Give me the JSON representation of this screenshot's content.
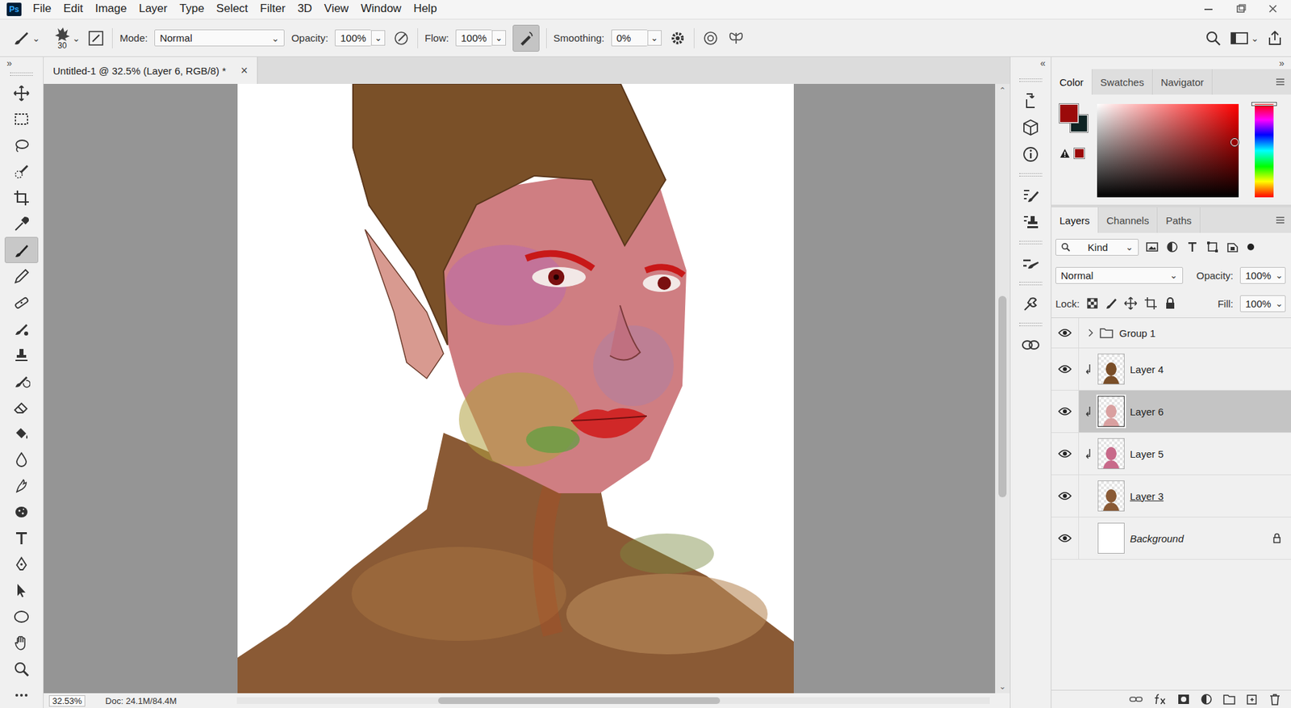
{
  "app": {
    "logo": "Ps"
  },
  "menu": [
    "File",
    "Edit",
    "Image",
    "Layer",
    "Type",
    "Select",
    "Filter",
    "3D",
    "View",
    "Window",
    "Help"
  ],
  "options_bar": {
    "brush_size": "30",
    "mode_label": "Mode:",
    "mode": "Normal",
    "opacity_label": "Opacity:",
    "opacity": "100%",
    "flow_label": "Flow:",
    "flow": "100%",
    "airbrush_on": true,
    "smoothing_label": "Smoothing:",
    "smoothing": "0%"
  },
  "tools": [
    {
      "kind": "move",
      "selected": false
    },
    {
      "kind": "marquee",
      "selected": false
    },
    {
      "kind": "lasso",
      "selected": false
    },
    {
      "kind": "quickselect",
      "selected": false
    },
    {
      "kind": "crop",
      "selected": false
    },
    {
      "kind": "eyedropper",
      "selected": false
    },
    {
      "kind": "brush",
      "selected": true
    },
    {
      "kind": "pencil",
      "selected": false
    },
    {
      "kind": "healing",
      "selected": false
    },
    {
      "kind": "mixer",
      "selected": false
    },
    {
      "kind": "stamp",
      "selected": false
    },
    {
      "kind": "history",
      "selected": false
    },
    {
      "kind": "eraser",
      "selected": false
    },
    {
      "kind": "bucket",
      "selected": false
    },
    {
      "kind": "blur",
      "selected": false
    },
    {
      "kind": "smudge",
      "selected": false
    },
    {
      "kind": "sponge",
      "selected": false
    },
    {
      "kind": "type",
      "selected": false
    },
    {
      "kind": "pen",
      "selected": false
    },
    {
      "kind": "pathselect",
      "selected": false
    },
    {
      "kind": "ellipse",
      "selected": false
    },
    {
      "kind": "hand",
      "selected": false
    },
    {
      "kind": "zoom",
      "selected": false
    },
    {
      "kind": "more",
      "selected": false
    }
  ],
  "document": {
    "tab": "Untitled-1 @ 32.5% (Layer 6, RGB/8) *",
    "close": "×",
    "zoom": "32.53%",
    "doc_size": "Doc: 24.1M/84.4M"
  },
  "color_panel": {
    "tabs": [
      {
        "label": "Color",
        "selected": true
      },
      {
        "label": "Swatches",
        "selected": false
      },
      {
        "label": "Navigator",
        "selected": false
      }
    ],
    "foreground": "#9b0a0a",
    "background": "#0f2424",
    "hue": 0,
    "saturation": 0.97,
    "brightness": 0.59
  },
  "layers_panel": {
    "tabs": [
      {
        "label": "Layers",
        "selected": true
      },
      {
        "label": "Channels",
        "selected": false
      },
      {
        "label": "Paths",
        "selected": false
      }
    ],
    "filter": "Kind",
    "blend_mode": "Normal",
    "opacity_label": "Opacity:",
    "opacity": "100%",
    "lock_label": "Lock:",
    "fill_label": "Fill:",
    "fill": "100%",
    "layers": [
      {
        "name": "Group 1",
        "kind": "group",
        "visible": true,
        "clipped": false,
        "selected": false,
        "underlined": false,
        "locked": false,
        "color": "#f0f0f0"
      },
      {
        "name": "Layer 4",
        "kind": "layer",
        "visible": true,
        "clipped": true,
        "selected": false,
        "underlined": false,
        "locked": false,
        "color": "#7a4e28"
      },
      {
        "name": "Layer 6",
        "kind": "layer",
        "visible": true,
        "clipped": true,
        "selected": true,
        "underlined": false,
        "locked": false,
        "color": "#d9a0a0"
      },
      {
        "name": "Layer 5",
        "kind": "layer",
        "visible": true,
        "clipped": true,
        "selected": false,
        "underlined": false,
        "locked": false,
        "color": "#c86a8a"
      },
      {
        "name": "Layer 3",
        "kind": "layer",
        "visible": true,
        "clipped": false,
        "selected": false,
        "underlined": true,
        "locked": false,
        "color": "#8a5a35"
      },
      {
        "name": "Background",
        "kind": "background",
        "visible": true,
        "clipped": false,
        "selected": false,
        "underlined": false,
        "locked": true,
        "color": "#ffffff"
      }
    ]
  }
}
